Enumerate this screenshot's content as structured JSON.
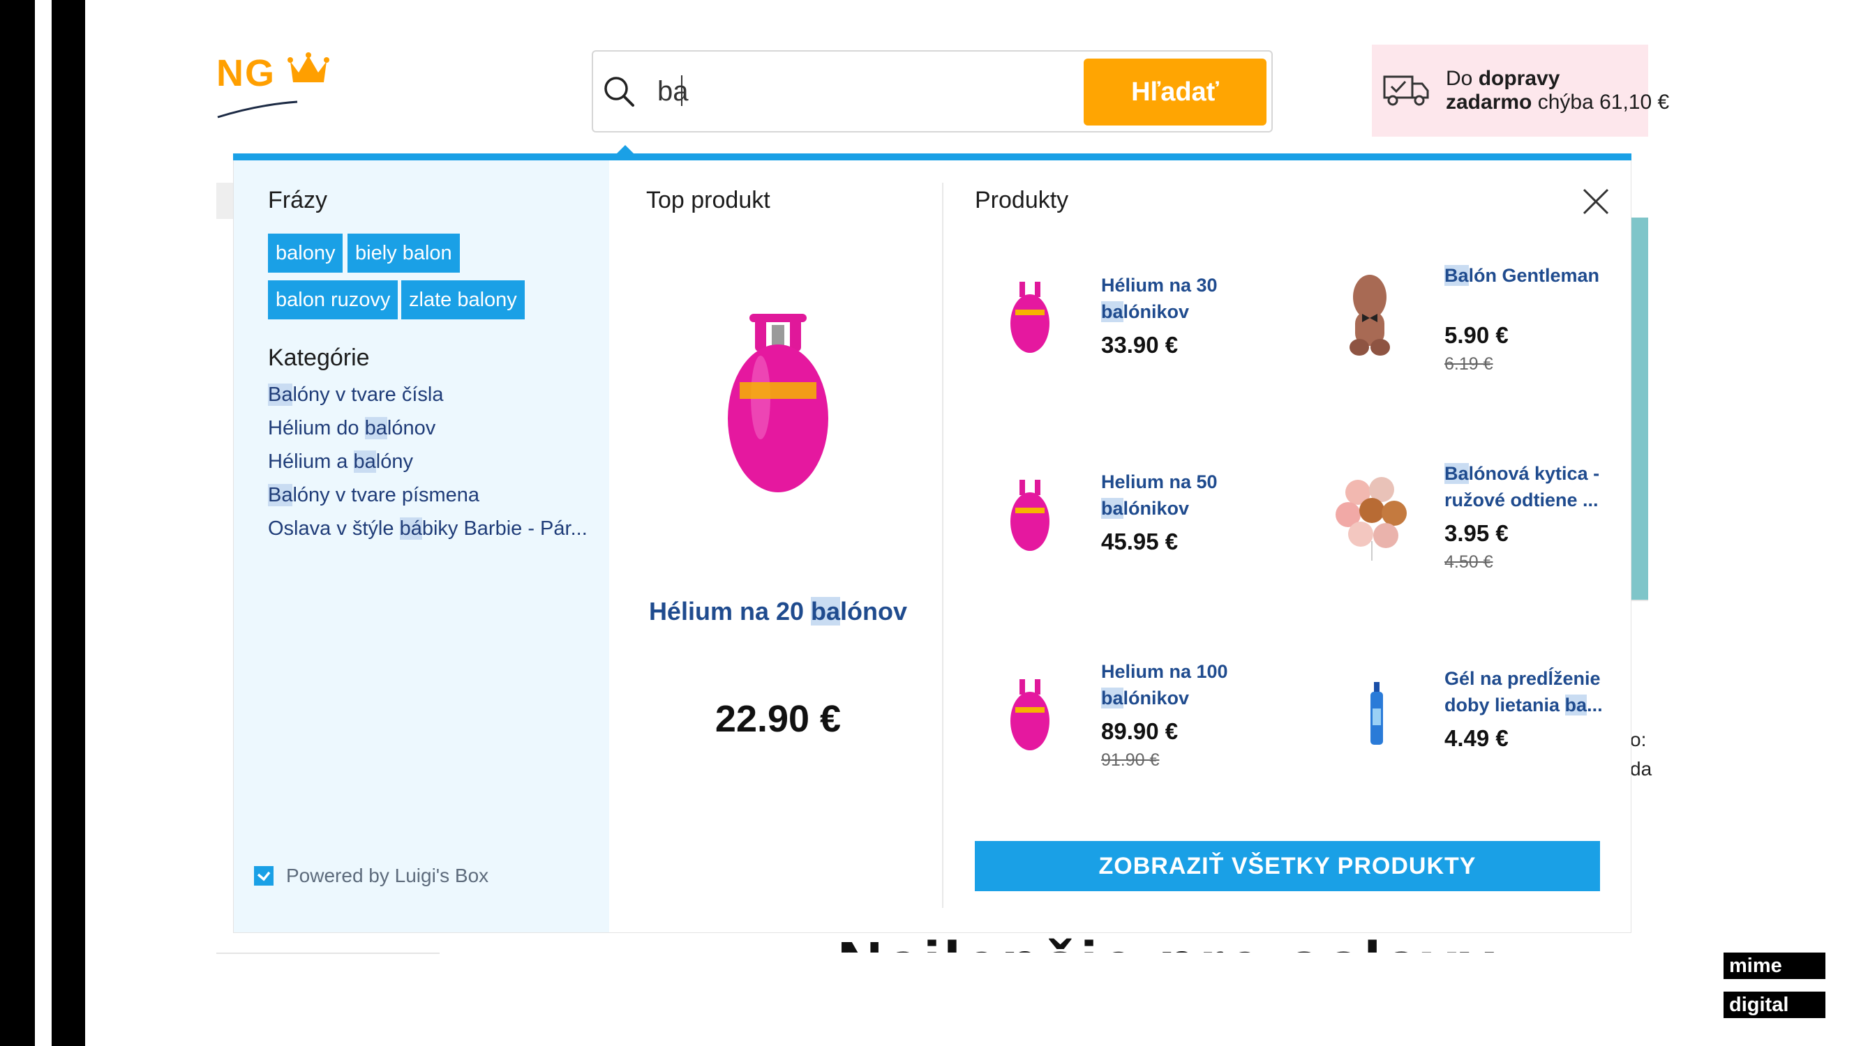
{
  "header": {
    "logo_text": "NG",
    "search": {
      "value": "ba",
      "button_label": "Hľadať"
    },
    "shipping": {
      "prefix": "Do ",
      "bold1": "dopravy",
      "bold2": "zadarmo",
      "suffix": " chýba 61,10 €"
    }
  },
  "dropdown": {
    "phrases": {
      "title": "Frázy",
      "chips": [
        "balony",
        "biely balon",
        "balon ruzovy",
        "zlate balony"
      ]
    },
    "categories": {
      "title": "Kategórie",
      "items": [
        {
          "hl": "Ba",
          "rest": "lóny v tvare čísla",
          "pre": ""
        },
        {
          "pre": "Hélium do ",
          "hl": "ba",
          "rest": "lónov"
        },
        {
          "pre": "Hélium a ",
          "hl": "ba",
          "rest": "lóny"
        },
        {
          "pre": "",
          "hl": "Ba",
          "rest": "lóny v tvare písmena"
        },
        {
          "pre": "Oslava v štýle ",
          "hl": "bá",
          "rest": "biky Barbie - Pár..."
        }
      ]
    },
    "powered_by": "Powered by Luigi's Box",
    "top_product": {
      "title": "Top produkt",
      "name_pre": "Hélium na 20 ",
      "name_hl": "ba",
      "name_rest": "lónov",
      "price": "22.90 €"
    },
    "products": {
      "title": "Produkty",
      "items": [
        {
          "name_pre": "Hélium na 30 ",
          "name_hl": "ba",
          "name_rest": "lónikov",
          "price": "33.90 €",
          "old_price": "",
          "image": "helium-tank-icon"
        },
        {
          "name_pre": "",
          "name_hl": "Ba",
          "name_rest": "lón Gentleman",
          "price": "5.90 €",
          "old_price": "6.19 €",
          "image": "balloon-gentleman-icon"
        },
        {
          "name_pre": "Helium na 50 ",
          "name_hl": "ba",
          "name_rest": "lónikov",
          "price": "45.95 €",
          "old_price": "",
          "image": "helium-tank-icon"
        },
        {
          "name_pre": "",
          "name_hl": "Ba",
          "name_rest": "lónová kytica - ružové odtiene ...",
          "price": "3.95 €",
          "old_price": "4.50 €",
          "image": "balloon-bouquet-icon"
        },
        {
          "name_pre": "Helium na 100 ",
          "name_hl": "ba",
          "name_rest": "lónikov",
          "price": "89.90 €",
          "old_price": "91.90 €",
          "image": "helium-tank-icon"
        },
        {
          "name_pre": "Gél na predĺženie doby lietania ",
          "name_hl": "ba",
          "name_rest": "...",
          "price": "4.49 €",
          "old_price": "",
          "image": "gel-bottle-icon"
        }
      ],
      "show_all_label": "ZOBRAZIŤ VŠETKY PRODUKTY"
    }
  },
  "background": {
    "right_text_1": "o:",
    "right_text_2": "da",
    "heading_hint": "Najlepšie pre oslavy"
  },
  "branding": {
    "line1": "mime",
    "line2": "digital"
  },
  "colors": {
    "accent_blue": "#1aa0e6",
    "accent_orange": "#ffa502",
    "link_blue": "#1f4b8e",
    "shipping_bg": "#fde7ec"
  }
}
